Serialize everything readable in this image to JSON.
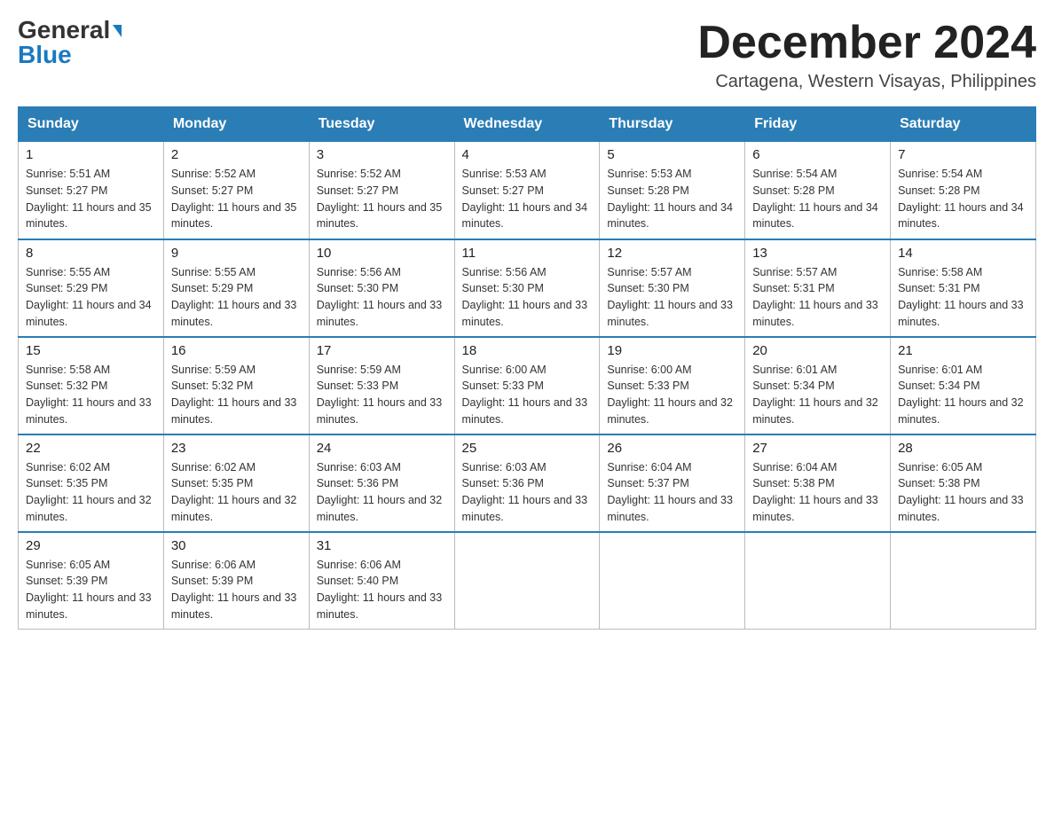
{
  "header": {
    "logo_general": "General",
    "logo_blue": "Blue",
    "month_title": "December 2024",
    "location": "Cartagena, Western Visayas, Philippines"
  },
  "days_of_week": [
    "Sunday",
    "Monday",
    "Tuesday",
    "Wednesday",
    "Thursday",
    "Friday",
    "Saturday"
  ],
  "weeks": [
    [
      {
        "day": "1",
        "sunrise": "5:51 AM",
        "sunset": "5:27 PM",
        "daylight": "11 hours and 35 minutes."
      },
      {
        "day": "2",
        "sunrise": "5:52 AM",
        "sunset": "5:27 PM",
        "daylight": "11 hours and 35 minutes."
      },
      {
        "day": "3",
        "sunrise": "5:52 AM",
        "sunset": "5:27 PM",
        "daylight": "11 hours and 35 minutes."
      },
      {
        "day": "4",
        "sunrise": "5:53 AM",
        "sunset": "5:27 PM",
        "daylight": "11 hours and 34 minutes."
      },
      {
        "day": "5",
        "sunrise": "5:53 AM",
        "sunset": "5:28 PM",
        "daylight": "11 hours and 34 minutes."
      },
      {
        "day": "6",
        "sunrise": "5:54 AM",
        "sunset": "5:28 PM",
        "daylight": "11 hours and 34 minutes."
      },
      {
        "day": "7",
        "sunrise": "5:54 AM",
        "sunset": "5:28 PM",
        "daylight": "11 hours and 34 minutes."
      }
    ],
    [
      {
        "day": "8",
        "sunrise": "5:55 AM",
        "sunset": "5:29 PM",
        "daylight": "11 hours and 34 minutes."
      },
      {
        "day": "9",
        "sunrise": "5:55 AM",
        "sunset": "5:29 PM",
        "daylight": "11 hours and 33 minutes."
      },
      {
        "day": "10",
        "sunrise": "5:56 AM",
        "sunset": "5:30 PM",
        "daylight": "11 hours and 33 minutes."
      },
      {
        "day": "11",
        "sunrise": "5:56 AM",
        "sunset": "5:30 PM",
        "daylight": "11 hours and 33 minutes."
      },
      {
        "day": "12",
        "sunrise": "5:57 AM",
        "sunset": "5:30 PM",
        "daylight": "11 hours and 33 minutes."
      },
      {
        "day": "13",
        "sunrise": "5:57 AM",
        "sunset": "5:31 PM",
        "daylight": "11 hours and 33 minutes."
      },
      {
        "day": "14",
        "sunrise": "5:58 AM",
        "sunset": "5:31 PM",
        "daylight": "11 hours and 33 minutes."
      }
    ],
    [
      {
        "day": "15",
        "sunrise": "5:58 AM",
        "sunset": "5:32 PM",
        "daylight": "11 hours and 33 minutes."
      },
      {
        "day": "16",
        "sunrise": "5:59 AM",
        "sunset": "5:32 PM",
        "daylight": "11 hours and 33 minutes."
      },
      {
        "day": "17",
        "sunrise": "5:59 AM",
        "sunset": "5:33 PM",
        "daylight": "11 hours and 33 minutes."
      },
      {
        "day": "18",
        "sunrise": "6:00 AM",
        "sunset": "5:33 PM",
        "daylight": "11 hours and 33 minutes."
      },
      {
        "day": "19",
        "sunrise": "6:00 AM",
        "sunset": "5:33 PM",
        "daylight": "11 hours and 32 minutes."
      },
      {
        "day": "20",
        "sunrise": "6:01 AM",
        "sunset": "5:34 PM",
        "daylight": "11 hours and 32 minutes."
      },
      {
        "day": "21",
        "sunrise": "6:01 AM",
        "sunset": "5:34 PM",
        "daylight": "11 hours and 32 minutes."
      }
    ],
    [
      {
        "day": "22",
        "sunrise": "6:02 AM",
        "sunset": "5:35 PM",
        "daylight": "11 hours and 32 minutes."
      },
      {
        "day": "23",
        "sunrise": "6:02 AM",
        "sunset": "5:35 PM",
        "daylight": "11 hours and 32 minutes."
      },
      {
        "day": "24",
        "sunrise": "6:03 AM",
        "sunset": "5:36 PM",
        "daylight": "11 hours and 32 minutes."
      },
      {
        "day": "25",
        "sunrise": "6:03 AM",
        "sunset": "5:36 PM",
        "daylight": "11 hours and 33 minutes."
      },
      {
        "day": "26",
        "sunrise": "6:04 AM",
        "sunset": "5:37 PM",
        "daylight": "11 hours and 33 minutes."
      },
      {
        "day": "27",
        "sunrise": "6:04 AM",
        "sunset": "5:38 PM",
        "daylight": "11 hours and 33 minutes."
      },
      {
        "day": "28",
        "sunrise": "6:05 AM",
        "sunset": "5:38 PM",
        "daylight": "11 hours and 33 minutes."
      }
    ],
    [
      {
        "day": "29",
        "sunrise": "6:05 AM",
        "sunset": "5:39 PM",
        "daylight": "11 hours and 33 minutes."
      },
      {
        "day": "30",
        "sunrise": "6:06 AM",
        "sunset": "5:39 PM",
        "daylight": "11 hours and 33 minutes."
      },
      {
        "day": "31",
        "sunrise": "6:06 AM",
        "sunset": "5:40 PM",
        "daylight": "11 hours and 33 minutes."
      },
      null,
      null,
      null,
      null
    ]
  ]
}
